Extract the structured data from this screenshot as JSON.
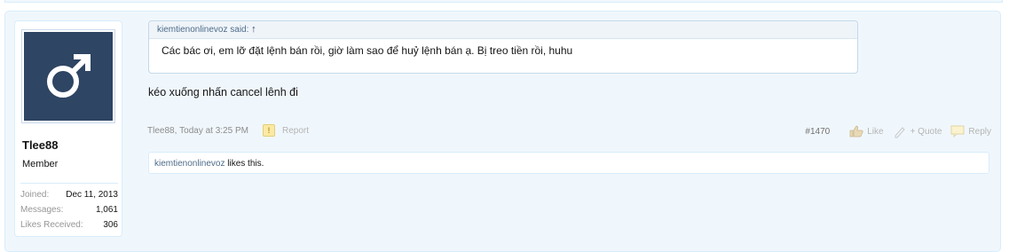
{
  "user": {
    "name": "Tlee88",
    "title": "Member",
    "avatar_icon": "male-symbol-icon",
    "stats": [
      {
        "label": "Joined:",
        "value": "Dec 11, 2013"
      },
      {
        "label": "Messages:",
        "value": "1,061"
      },
      {
        "label": "Likes Received:",
        "value": "306"
      }
    ]
  },
  "quote": {
    "author_said": "kiemtienonlinevoz said:",
    "arrow": "↑",
    "text": "Các bác ơi, em lỡ đặt lệnh bán rồi, giờ làm sao để huỷ lệnh bán ạ. Bị treo tiền rồi, huhu"
  },
  "message": "kéo xuống nhấn cancel lênh đi",
  "meta": {
    "author": "Tlee88",
    "time": "Today at 3:25 PM",
    "report": "Report"
  },
  "actions": {
    "post_number": "#1470",
    "like": "Like",
    "quote": "+ Quote",
    "reply": "Reply"
  },
  "likes": {
    "liker": "kiemtienonlinevoz",
    "suffix": " likes this."
  },
  "colors": {
    "avatar_bg": "#2e4563",
    "panel_bg": "#f0f7fc",
    "border": "#d7edfc"
  }
}
